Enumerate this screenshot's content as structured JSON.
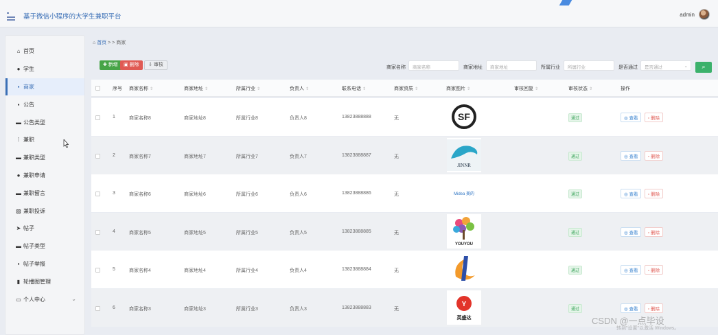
{
  "header": {
    "app_title": "基于微信小程序的大学生兼职平台",
    "user": "admin"
  },
  "sidebar": {
    "items": [
      {
        "label": "首页",
        "icon": "home-icon"
      },
      {
        "label": "学生",
        "icon": "user-icon"
      },
      {
        "label": "商家",
        "icon": "grid-icon"
      },
      {
        "label": "公告",
        "icon": "grid-icon"
      },
      {
        "label": "公告类型",
        "icon": "card-icon"
      },
      {
        "label": "兼职",
        "icon": "dots-grid-icon"
      },
      {
        "label": "兼职类型",
        "icon": "card-icon"
      },
      {
        "label": "兼职申请",
        "icon": "user-icon"
      },
      {
        "label": "兼职留言",
        "icon": "card-icon"
      },
      {
        "label": "兼职投诉",
        "icon": "image-icon"
      },
      {
        "label": "帖子",
        "icon": "send-icon"
      },
      {
        "label": "帖子类型",
        "icon": "card-icon"
      },
      {
        "label": "帖子举报",
        "icon": "grid-icon"
      },
      {
        "label": "轮播图管理",
        "icon": "bar-chart-icon"
      },
      {
        "label": "个人中心",
        "icon": "folder-icon"
      }
    ],
    "active_index": 2
  },
  "breadcrumb": {
    "home": "首页",
    "separator": ">",
    "current": "商家"
  },
  "toolbar": {
    "add_label": "新增",
    "delete_label": "删除",
    "audit_label": "审核",
    "filters": [
      {
        "label": "商家名称",
        "placeholder": "商家名称"
      },
      {
        "label": "商家地址",
        "placeholder": "商家地址"
      },
      {
        "label": "所属行业",
        "placeholder": "所属行业"
      },
      {
        "label": "是否通过",
        "placeholder": "是否通过"
      }
    ]
  },
  "table": {
    "columns": [
      "序号",
      "商家名称",
      "商家地址",
      "所属行业",
      "负责人",
      "联系电话",
      "商家资质",
      "商家图片",
      "审核回复",
      "审核状态",
      "操作"
    ],
    "rows": [
      {
        "index": "1",
        "name": "商家名称8",
        "address": "商家地址8",
        "industry": "所属行业8",
        "manager": "负责人8",
        "phone": "13823888888",
        "qualification": "无",
        "logo": "sf",
        "reply": "",
        "status": "通过"
      },
      {
        "index": "2",
        "name": "商家名称7",
        "address": "商家地址7",
        "industry": "所属行业7",
        "manager": "负责人7",
        "phone": "13823888887",
        "qualification": "无",
        "logo": "jinnr",
        "reply": "",
        "status": "通过"
      },
      {
        "index": "3",
        "name": "商家名称6",
        "address": "商家地址6",
        "industry": "所属行业6",
        "manager": "负责人6",
        "phone": "13823888886",
        "qualification": "无",
        "logo": "midea",
        "reply": "",
        "status": "通过"
      },
      {
        "index": "4",
        "name": "商家名称5",
        "address": "商家地址5",
        "industry": "所属行业5",
        "manager": "负责人5",
        "phone": "13823888885",
        "qualification": "无",
        "logo": "youyou",
        "reply": "",
        "status": "通过"
      },
      {
        "index": "5",
        "name": "商家名称4",
        "address": "商家地址4",
        "industry": "所属行业4",
        "manager": "负责人4",
        "phone": "13823888884",
        "qualification": "无",
        "logo": "swirl",
        "reply": "",
        "status": "通过"
      },
      {
        "index": "6",
        "name": "商家名称3",
        "address": "商家地址3",
        "industry": "所属行业3",
        "manager": "负责人3",
        "phone": "13823888883",
        "qualification": "无",
        "logo": "yingda",
        "reply": "",
        "status": "通过"
      }
    ],
    "view_label": "查看",
    "delete_label": "删除"
  },
  "logos": {
    "jinnr_text": "JINNR",
    "midea_text": "Midea 美的",
    "youyou_text": "YOUYOU",
    "yingda_text": "英盛达"
  },
  "overlay": {
    "watermark": "CSDN @一点毕设",
    "activate": "转到\"设置\"以激活 Windows。"
  }
}
